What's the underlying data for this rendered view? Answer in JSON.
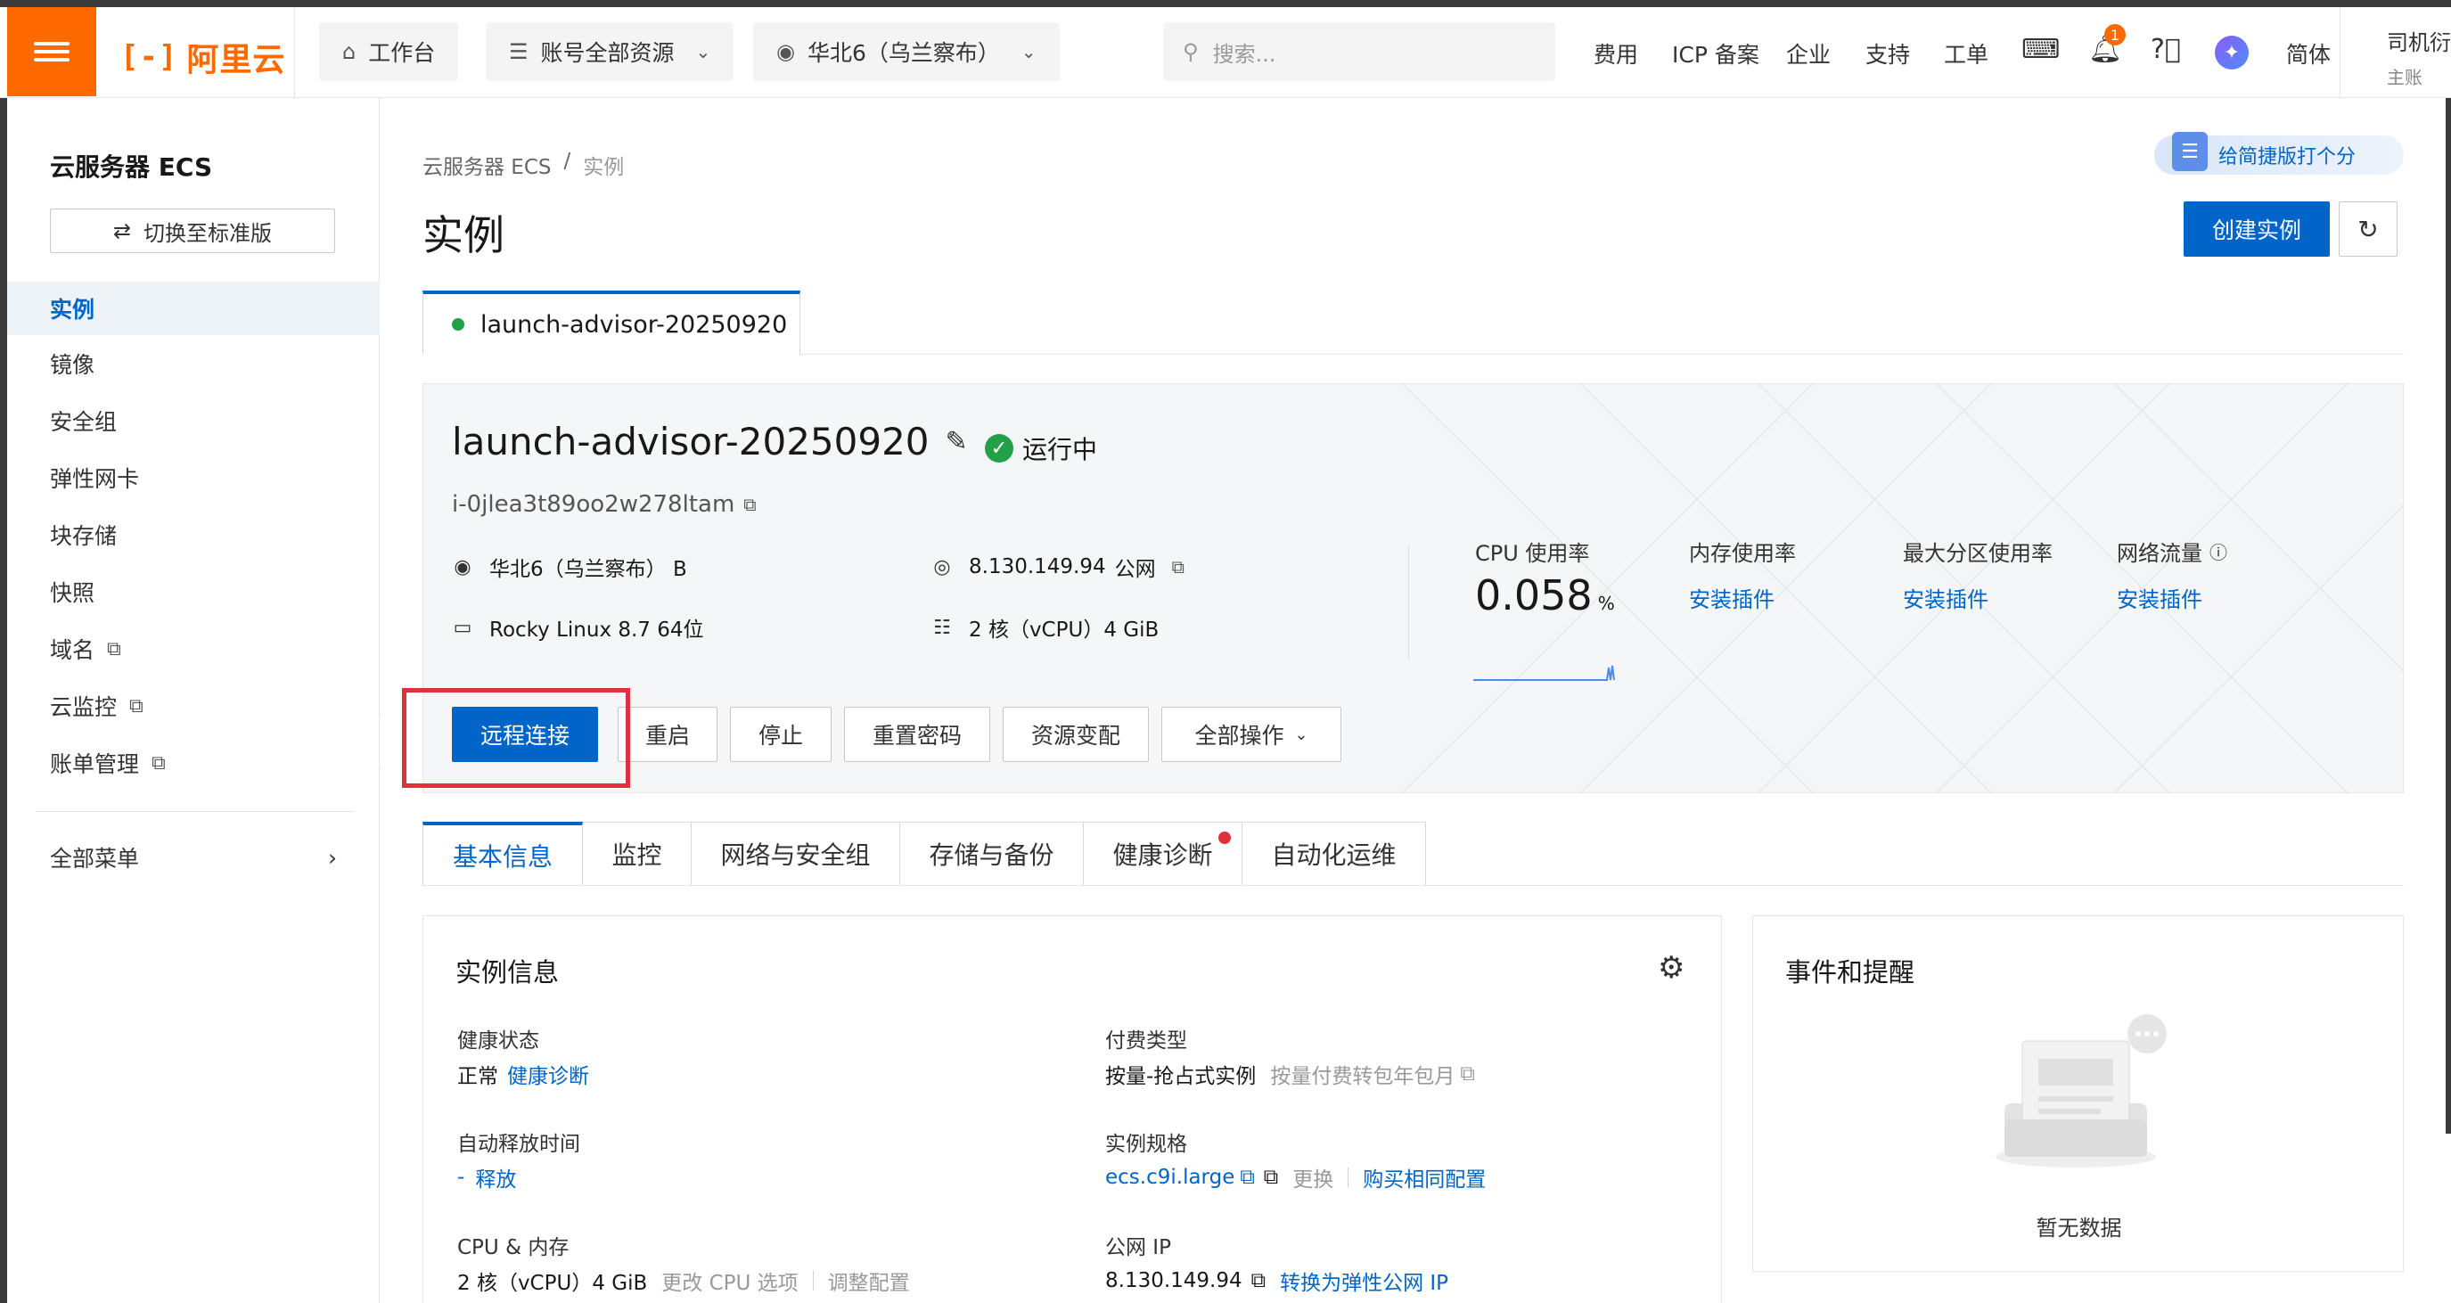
{
  "topbar": {
    "logo_text": "阿里云",
    "workbench": "工作台",
    "account_resources": "账号全部资源",
    "region": "华北6（乌兰察布）",
    "search_placeholder": "搜索...",
    "nav": [
      "费用",
      "ICP 备案",
      "企业",
      "支持",
      "工单"
    ],
    "bell_count": "1",
    "lang": "简体",
    "user_name": "司机衍",
    "user_sub": "主账"
  },
  "sidebar": {
    "title": "云服务器 ECS",
    "switch_label": "切换至标准版",
    "items": [
      {
        "label": "实例",
        "active": true
      },
      {
        "label": "镜像"
      },
      {
        "label": "安全组"
      },
      {
        "label": "弹性网卡"
      },
      {
        "label": "块存储"
      },
      {
        "label": "快照"
      },
      {
        "label": "域名",
        "external": true
      },
      {
        "label": "云监控",
        "external": true
      },
      {
        "label": "账单管理",
        "external": true
      }
    ],
    "all_menu": "全部菜单"
  },
  "breadcrumb": [
    "云服务器 ECS",
    "实例"
  ],
  "feedback_label": "给简捷版打个分",
  "page_title": "实例",
  "create_button": "创建实例",
  "instance_tab": "launch-advisor-20250920",
  "instance": {
    "name": "launch-advisor-20250920",
    "status": "运行中",
    "id": "i-0jlea3t89oo2w278ltam",
    "zone": "华北6（乌兰察布） B",
    "public_ip": "8.130.149.94",
    "public_ip_suffix": "公网",
    "os": "Rocky Linux 8.7 64位",
    "spec": "2 核（vCPU）4 GiB"
  },
  "metrics": {
    "cpu_label": "CPU 使用率",
    "cpu_value": "0.058",
    "cpu_unit": "%",
    "mem_label": "内存使用率",
    "disk_label": "最大分区使用率",
    "net_label": "网络流量",
    "install_plugin": "安装插件"
  },
  "actions": {
    "remote": "远程连接",
    "restart": "重启",
    "stop": "停止",
    "reset_password": "重置密码",
    "resize": "资源变配",
    "all_ops": "全部操作"
  },
  "detail_tabs": [
    "基本信息",
    "监控",
    "网络与安全组",
    "存储与备份",
    "健康诊断",
    "自动化运维"
  ],
  "info": {
    "title": "实例信息",
    "health_label": "健康状态",
    "health_value": "正常",
    "health_link": "健康诊断",
    "auto_release_label": "自动释放时间",
    "auto_release_value": "-",
    "auto_release_link": "释放",
    "cpu_mem_label": "CPU & 内存",
    "cpu_mem_value": "2 核（vCPU）4 GiB",
    "cpu_mem_change": "更改 CPU 选项",
    "cpu_mem_adjust": "调整配置",
    "billing_label": "付费类型",
    "billing_value": "按量-抢占式实例",
    "billing_convert": "按量付费转包年包月",
    "spec_label": "实例规格",
    "spec_value": "ecs.c9i.large",
    "spec_change": "更换",
    "spec_buy": "购买相同配置",
    "public_ip_label": "公网 IP",
    "public_ip_value": "8.130.149.94",
    "public_ip_convert": "转换为弹性公网 IP"
  },
  "events": {
    "title": "事件和提醒",
    "empty": "暂无数据"
  }
}
